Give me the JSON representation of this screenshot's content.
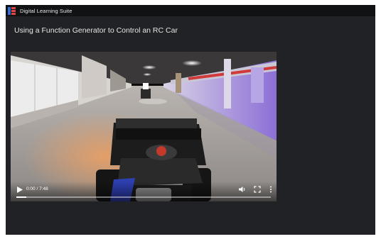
{
  "app": {
    "title": "Digital Learning Suite",
    "logo_icon": "logo-icon"
  },
  "lesson": {
    "title": "Using a Function Generator to Control an RC Car"
  },
  "video": {
    "current_time": "0:00",
    "duration": "7:48",
    "time_display": "0:00 / 7:48",
    "progress_fraction": 0.0,
    "controls": {
      "play_icon": "play-icon",
      "volume_icon": "volume-icon",
      "fullscreen_icon": "fullscreen-icon",
      "menu_icon": "more-vertical-icon"
    }
  },
  "colors": {
    "background": "#212225",
    "topbar": "#111214",
    "logo_blue": "#2f6fd6",
    "logo_red": "#e04545"
  }
}
